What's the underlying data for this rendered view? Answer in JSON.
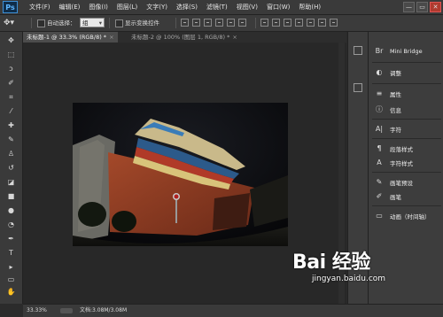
{
  "app": {
    "logo": "Ps"
  },
  "menu": [
    "文件(F)",
    "编辑(E)",
    "图像(I)",
    "图层(L)",
    "文字(Y)",
    "选择(S)",
    "滤镜(T)",
    "视图(V)",
    "窗口(W)",
    "帮助(H)"
  ],
  "window_controls": {
    "minimize": "—",
    "restore": "▭",
    "close": "✕"
  },
  "options": {
    "auto_select_label": "自动选择：",
    "auto_select_value": "组",
    "show_transform_label": "显示变换控件"
  },
  "tabs": [
    {
      "label": "未标题-1 @ 33.3% (RGB/8) *",
      "close": "×",
      "active": true
    },
    {
      "label": "未标题-2 @ 100% (图层 1, RGB/8) *",
      "close": "×",
      "active": false
    }
  ],
  "status": {
    "zoom": "33.33%",
    "doc": "文档:3.08M/3.08M"
  },
  "panels": [
    {
      "icon": "Br",
      "label": "Mini Bridge"
    },
    {
      "icon": "◐",
      "label": "调整"
    },
    {
      "icon": "≡",
      "label": "属性"
    },
    {
      "icon": "ⓘ",
      "label": "信息"
    },
    {
      "icon": "A|",
      "label": "字符"
    },
    {
      "icon": "¶",
      "label": "段落样式"
    },
    {
      "icon": "A",
      "label": "字符样式"
    },
    {
      "icon": "✎",
      "label": "画笔预设"
    },
    {
      "icon": "✐",
      "label": "画笔"
    },
    {
      "icon": "▭",
      "label": "动画（时间轴）"
    }
  ],
  "watermark": {
    "main": "Bai 经验",
    "sub": "jingyan.baidu.com"
  },
  "colors": {
    "app_bg": "#2b2b2b",
    "panel_bg": "#3d3d3d",
    "ps_blue": "#3d8fd6",
    "wall_red": "#8a3b22"
  }
}
